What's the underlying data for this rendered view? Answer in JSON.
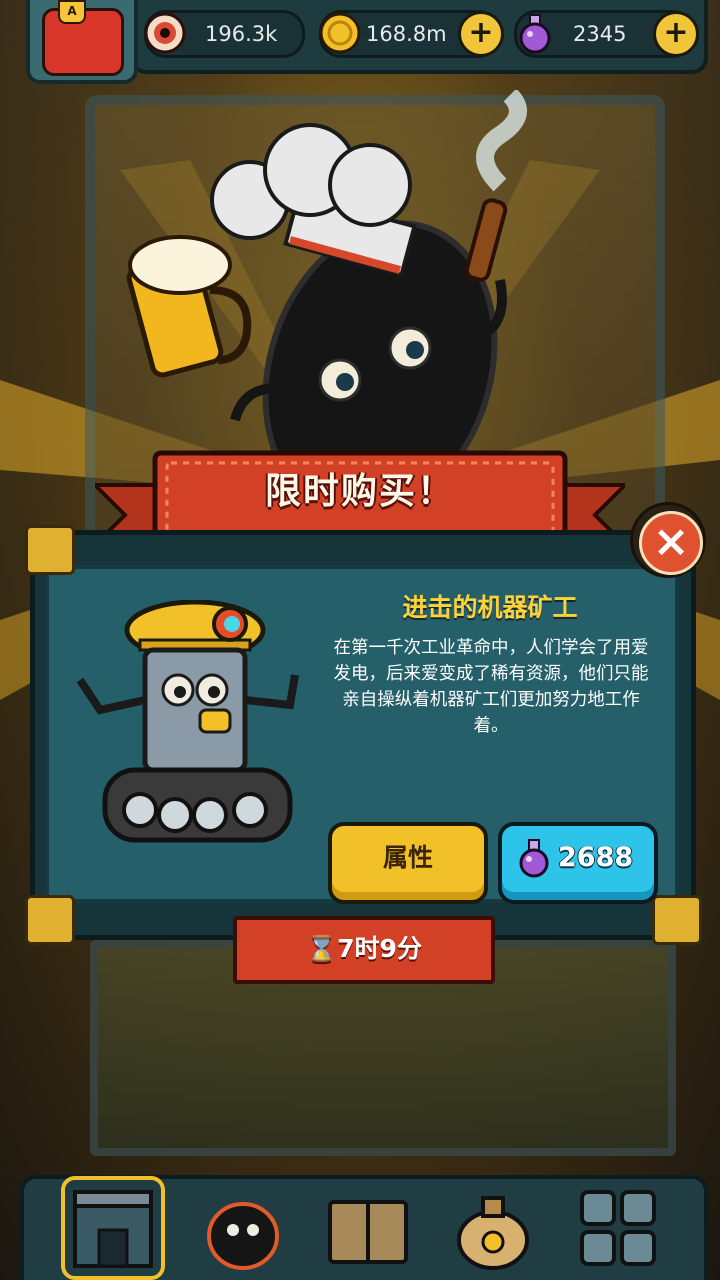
{
  "header": {
    "avatar_badge": "A",
    "resources": [
      {
        "icon": "eyeball-icon",
        "value": "196.3k",
        "has_plus": false
      },
      {
        "icon": "gold-coin-icon",
        "value": "168.8m",
        "has_plus": true
      },
      {
        "icon": "purple-potion-icon",
        "value": "2345",
        "has_plus": true
      }
    ],
    "plus_symbol": "+"
  },
  "offer": {
    "banner_title": "限时购买！",
    "close_symbol": "×",
    "item_name": "进击的机器矿工",
    "item_description": "在第一千次工业革命中，人们学会了用爱发电，后来爱变成了稀有资源，他们只能亲自操纵着机器矿工们更加努力地工作着。",
    "attributes_button": "属性",
    "price_value": "2688",
    "price_icon": "purple-potion-icon",
    "timer_text": "⌛7时9分"
  },
  "bottom_nav": {
    "items": [
      {
        "name": "nav-shop",
        "icon": "shop-icon",
        "selected": true
      },
      {
        "name": "nav-monsters",
        "icon": "monster-icon",
        "selected": false
      },
      {
        "name": "nav-book",
        "icon": "book-icon",
        "selected": false
      },
      {
        "name": "nav-bag",
        "icon": "money-bag-icon",
        "selected": false
      },
      {
        "name": "nav-grid",
        "icon": "grid-icon",
        "selected": false
      }
    ]
  },
  "colors": {
    "panel": "#25606a",
    "ribbon": "#d24126",
    "gold": "#f2c029",
    "cyan": "#2ec3e8"
  }
}
